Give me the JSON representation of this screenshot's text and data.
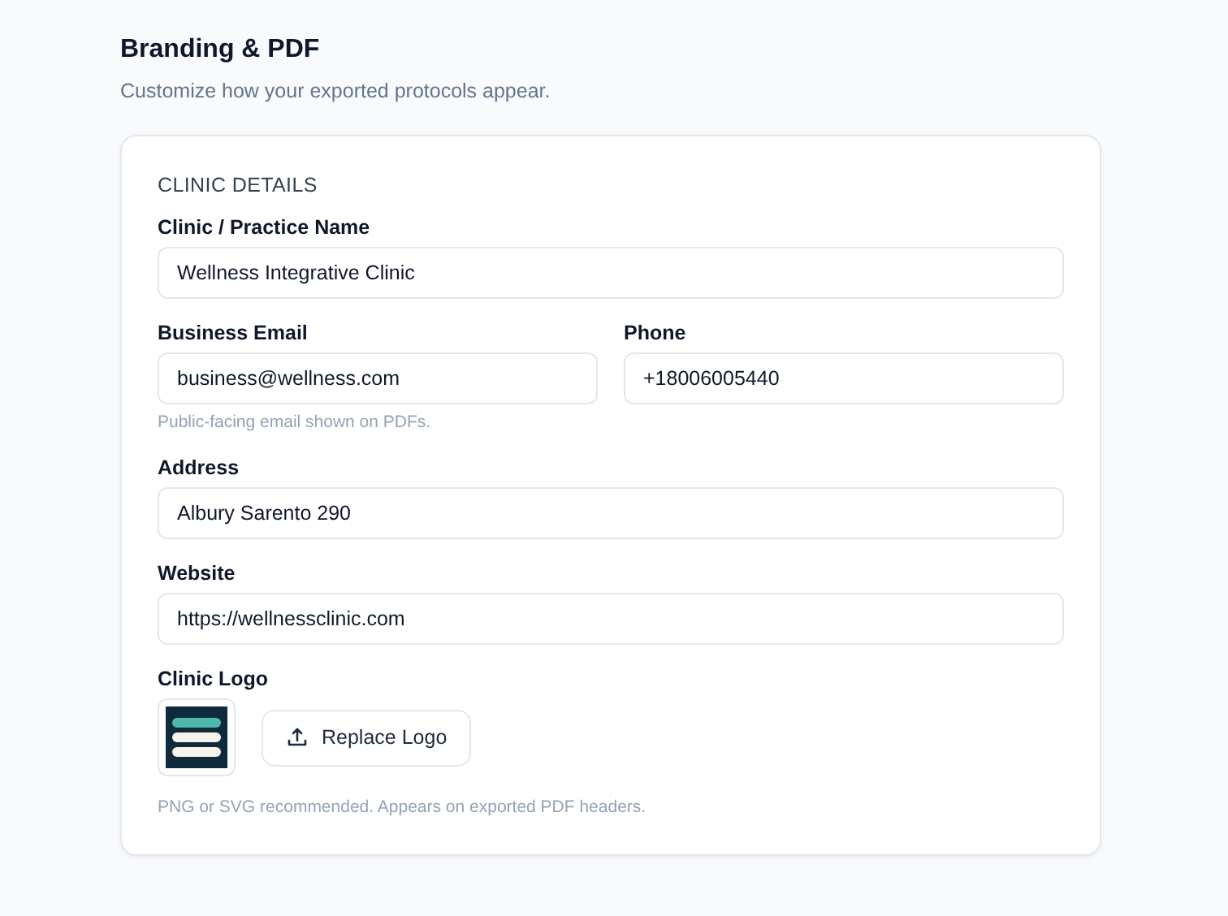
{
  "header": {
    "title": "Branding & PDF",
    "subtitle": "Customize how your exported protocols appear."
  },
  "section_title": "CLINIC DETAILS",
  "rows": [
    [
      {
        "label": "Clinic / Practice Name",
        "value": "Wellness Integrative Clinic"
      }
    ],
    [
      {
        "label": "Business Email",
        "value": "business@wellness.com",
        "help": "Public-facing email shown on PDFs."
      },
      {
        "label": "Phone",
        "value": "+18006005440"
      }
    ],
    [
      {
        "label": "Address",
        "value": "Albury Sarento 290"
      }
    ],
    [
      {
        "label": "Website",
        "value": "https://wellnessclinic.com"
      }
    ]
  ],
  "logo": {
    "label": "Clinic Logo",
    "button": "Replace Logo",
    "help": "PNG or SVG recommended. Appears on exported PDF headers."
  }
}
